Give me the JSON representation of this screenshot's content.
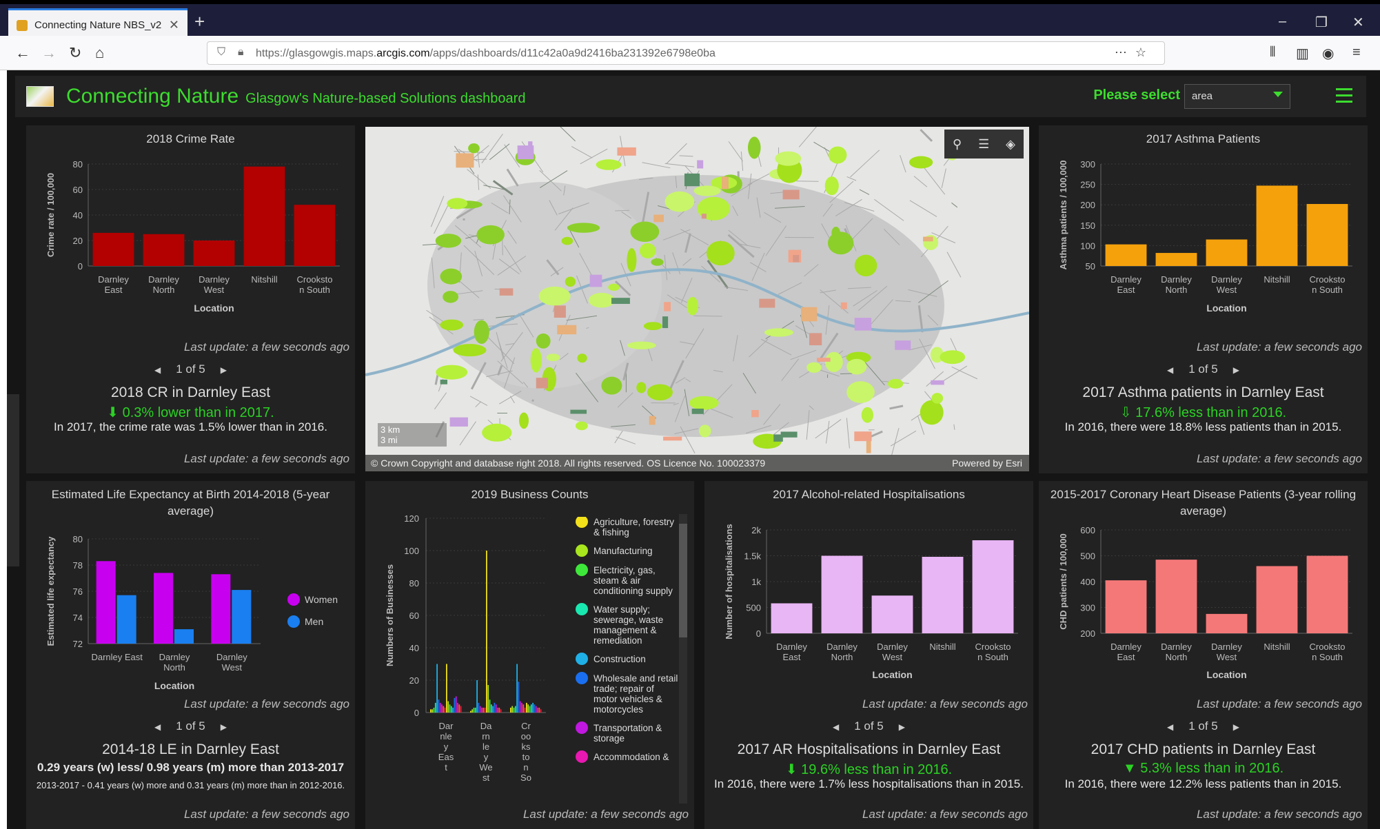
{
  "browser": {
    "tab_title": "Connecting Nature NBS_v2",
    "url_prefix": "https://glasgowgis.maps.",
    "url_domain": "arcgis.com",
    "url_rest": "/apps/dashboards/d11c42a0a9d2416ba231392e6798e0ba"
  },
  "header": {
    "title": "Connecting Nature",
    "subtitle": "Glasgow's Nature-based Solutions dashboard",
    "select_label": "Please select",
    "select_value": "area"
  },
  "common": {
    "last_update": "Last update: a few seconds ago",
    "pager": "1 of 5",
    "location": "Location"
  },
  "crime": {
    "title": "2018 Crime Rate",
    "headline": "2018 CR in Darnley East",
    "change": "0.3% lower than in 2017.",
    "detail": "In 2017, the crime rate was 1.5% lower than in 2016.",
    "chart_data": {
      "type": "bar",
      "color": "#b30000",
      "categories": [
        "Darnley East",
        "Darnley North",
        "Darnley West",
        "Nitshill",
        "Crookston South"
      ],
      "cat_lines": [
        [
          "Darnley",
          "East"
        ],
        [
          "Darnley",
          "North"
        ],
        [
          "Darnley",
          "West"
        ],
        [
          "Nitshill"
        ],
        [
          "Crooksto",
          "n South"
        ]
      ],
      "values": [
        26,
        25,
        20,
        78,
        48
      ],
      "ylim": [
        0,
        80
      ],
      "ticks": [
        0,
        20,
        40,
        60,
        80
      ],
      "ylabel": "Crime rate / 100,000",
      "xlabel": "Location"
    }
  },
  "asthma": {
    "title": "2017 Asthma Patients",
    "headline": "2017 Asthma patients in Darnley East",
    "change": "17.6% less than in 2016.",
    "detail": "In 2016, there were 18.8% less patients than in 2015.",
    "chart_data": {
      "type": "bar",
      "color": "#f5a10c",
      "categories": [
        "Darnley East",
        "Darnley North",
        "Darnley West",
        "Nitshill",
        "Crookston South"
      ],
      "cat_lines": [
        [
          "Darnley",
          "East"
        ],
        [
          "Darnley",
          "North"
        ],
        [
          "Darnley",
          "West"
        ],
        [
          "Nitshill"
        ],
        [
          "Crooksto",
          "n South"
        ]
      ],
      "values": [
        103,
        82,
        115,
        247,
        202
      ],
      "ylim": [
        50,
        300
      ],
      "ticks": [
        50,
        100,
        150,
        200,
        250,
        300
      ],
      "ylabel": "Asthma patients / 100,000",
      "xlabel": "Location"
    }
  },
  "life": {
    "title": "Estimated Life Expectancy at Birth 2014-2018 (5-year average)",
    "headline": "2014-18 LE in Darnley East",
    "change_bold": "0.29 years (w) less/ 0.98 years (m) more than 2013-2017",
    "detail_small": "2013-2017 - 0.41 years (w) more and 0.31 years (m) more than in 2012-2016.",
    "chart_data": {
      "type": "bar",
      "categories": [
        "Darnley East",
        "Darnley North",
        "Darnley West"
      ],
      "cat_lines": [
        [
          "Darnley East"
        ],
        [
          "Darnley",
          "North"
        ],
        [
          "Darnley",
          "West"
        ]
      ],
      "series": [
        {
          "name": "Women",
          "color": "#c800f0",
          "values": [
            78.3,
            77.4,
            77.3
          ]
        },
        {
          "name": "Men",
          "color": "#1a7ff0",
          "values": [
            75.7,
            73.1,
            76.1
          ]
        }
      ],
      "ylim": [
        72,
        80
      ],
      "ticks": [
        72,
        74,
        76,
        78,
        80
      ],
      "ylabel": "Estimated life expectancy",
      "xlabel": "Location"
    }
  },
  "business": {
    "title": "2019 Business Counts",
    "chart_data": {
      "type": "bar",
      "ylim": [
        0,
        120
      ],
      "ticks": [
        0,
        20,
        40,
        60,
        80,
        100,
        120
      ],
      "ylabel": "Numbers of Businesses",
      "cat_lines": [
        [
          "Dar",
          "nle",
          "y",
          "Eas",
          "t"
        ],
        [
          "Da",
          "rn",
          "le",
          "y",
          "We",
          "st"
        ],
        [
          "Cr",
          "oo",
          "ks",
          "to",
          "n",
          "So"
        ]
      ],
      "legend": [
        {
          "name": "Agriculture, forestry & fishing",
          "color": "#f2e11a"
        },
        {
          "name": "Manufacturing",
          "color": "#a8e61d"
        },
        {
          "name": "Electricity, gas, steam & air conditioning supply",
          "color": "#3ee83a"
        },
        {
          "name": "Water supply; sewerage, waste management & remediation",
          "color": "#19e8b0"
        },
        {
          "name": "Construction",
          "color": "#1fb0e8"
        },
        {
          "name": "Wholesale and retail trade; repair of motor vehicles & motorcycles",
          "color": "#1a6ff0"
        },
        {
          "name": "Transportation & storage",
          "color": "#c018e0"
        },
        {
          "name": "Accommodation &",
          "color": "#e818b0"
        }
      ],
      "groups": [
        [
          2,
          2,
          3,
          6,
          30,
          8,
          6,
          5,
          4,
          3,
          30,
          7,
          5,
          4,
          3,
          9,
          10,
          6,
          5,
          4
        ],
        [
          1,
          2,
          3,
          3,
          20,
          6,
          4,
          3,
          3,
          3,
          100,
          17,
          8,
          5,
          4,
          6,
          5,
          3,
          3,
          2
        ],
        [
          3,
          4,
          3,
          4,
          30,
          19,
          7,
          6,
          5,
          3,
          6,
          5,
          4,
          5,
          6,
          5,
          4,
          3,
          3,
          2
        ]
      ],
      "bar_colors": [
        "#f2e11a",
        "#a8e61d",
        "#3ee83a",
        "#19e8b0",
        "#1fb0e8",
        "#1a6ff0",
        "#c018e0",
        "#e818b0",
        "#f26a1a",
        "#e81a3a"
      ]
    }
  },
  "alcohol": {
    "title": "2017 Alcohol-related Hospitalisations",
    "headline": "2017 AR Hospitalisations in Darnley East",
    "change": "19.6% less than in 2016.",
    "detail": "In 2016, there were 1.7% less hospitalisations than in 2015.",
    "chart_data": {
      "type": "bar",
      "color": "#e8b5f5",
      "categories": [
        "Darnley East",
        "Darnley North",
        "Darnley West",
        "Nitshill",
        "Crookston South"
      ],
      "cat_lines": [
        [
          "Darnley",
          "East"
        ],
        [
          "Darnley",
          "North"
        ],
        [
          "Darnley",
          "West"
        ],
        [
          "Nitshill"
        ],
        [
          "Crooksto",
          "n South"
        ]
      ],
      "values": [
        580,
        1500,
        730,
        1480,
        1800
      ],
      "ylim": [
        0,
        2000
      ],
      "ticks": [
        0,
        500,
        1000,
        1500,
        2000
      ],
      "tick_labels": [
        "0",
        "500",
        "1k",
        "1.5k",
        "2k"
      ],
      "ylabel": "Number of hospitalisations",
      "xlabel": "Location"
    }
  },
  "chd": {
    "title": "2015-2017 Coronary Heart Disease Patients (3-year rolling average)",
    "headline": "2017 CHD patients in Darnley East",
    "change": "5.3% less than in 2016.",
    "detail": "In 2016, there were 12.2% less patients than in 2015.",
    "chart_data": {
      "type": "bar",
      "color": "#f57878",
      "categories": [
        "Darnley East",
        "Darnley North",
        "Darnley West",
        "Nitshill",
        "Crookston South"
      ],
      "cat_lines": [
        [
          "Darnley",
          "East"
        ],
        [
          "Darnley",
          "North"
        ],
        [
          "Darnley",
          "West"
        ],
        [
          "Nitshill"
        ],
        [
          "Crooksto",
          "n South"
        ]
      ],
      "values": [
        405,
        485,
        275,
        460,
        500
      ],
      "ylim": [
        200,
        600
      ],
      "ticks": [
        200,
        300,
        400,
        500,
        600
      ],
      "ylabel": "CHD patients / 100,000",
      "xlabel": "Location"
    }
  },
  "map": {
    "copyright": "© Crown Copyright and database right 2018. All rights reserved. OS Licence No. 100023379",
    "powered": "Powered by Esri",
    "scale_km": "3 km",
    "scale_mi": "3 mi"
  }
}
